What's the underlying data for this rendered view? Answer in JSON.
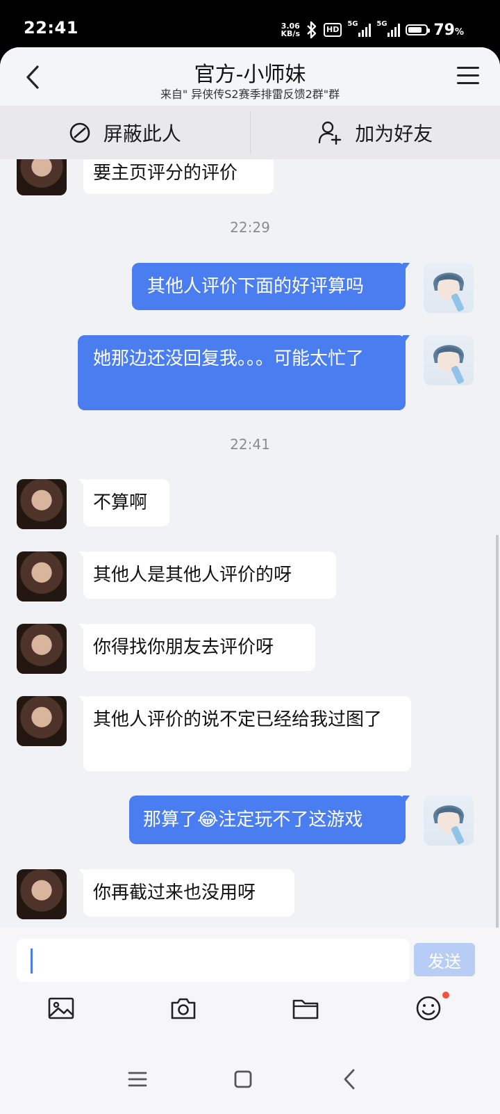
{
  "status_bar": {
    "time": "22:41",
    "net_speed_value": "3.06",
    "net_speed_unit": "KB/s",
    "hd_badge": "HD",
    "signal1_tag": "5G",
    "signal2_tag": "5G",
    "battery_percent": "79",
    "battery_percent_sign": "%",
    "battery_level": 0.79
  },
  "header": {
    "title": "官方-小师妹",
    "subtitle": "来自\" 异侠传S2赛季排雷反馈2群\"群"
  },
  "actions": {
    "block_label": "屏蔽此人",
    "add_friend_label": "加为好友"
  },
  "messages": [
    {
      "side": "in",
      "text": "要主页评分的评价"
    },
    {
      "side": "time",
      "text": "22:29"
    },
    {
      "side": "out",
      "text": "其他人评价下面的好评算吗"
    },
    {
      "side": "out",
      "text": "她那边还没回复我。。。可能太忙了"
    },
    {
      "side": "time",
      "text": "22:41"
    },
    {
      "side": "in",
      "text": "不算啊"
    },
    {
      "side": "in",
      "text": "其他人是其他人评价的呀"
    },
    {
      "side": "in",
      "text": "你得找你朋友去评价呀"
    },
    {
      "side": "in",
      "text": "其他人评价的说不定已经给我过图了"
    },
    {
      "side": "out",
      "text_before": "那算了",
      "emoji": "😂",
      "text_after": "注定玩不了这游戏"
    },
    {
      "side": "in",
      "text": "你再截过来也没用呀"
    }
  ],
  "composer": {
    "input_value": "",
    "send_label": "发送"
  },
  "toolbar": {
    "icons": [
      "image-icon",
      "camera-icon",
      "folder-icon",
      "emoji-icon"
    ]
  },
  "nav": {
    "icons": [
      "recent-apps-icon",
      "home-icon",
      "back-icon"
    ]
  },
  "colors": {
    "outgoing_bubble": "#4a7ef0",
    "incoming_bubble": "#ffffff",
    "chat_background": "#f1f2f6",
    "send_button_disabled": "#b8cdf6",
    "notification_dot": "#f2533f"
  }
}
